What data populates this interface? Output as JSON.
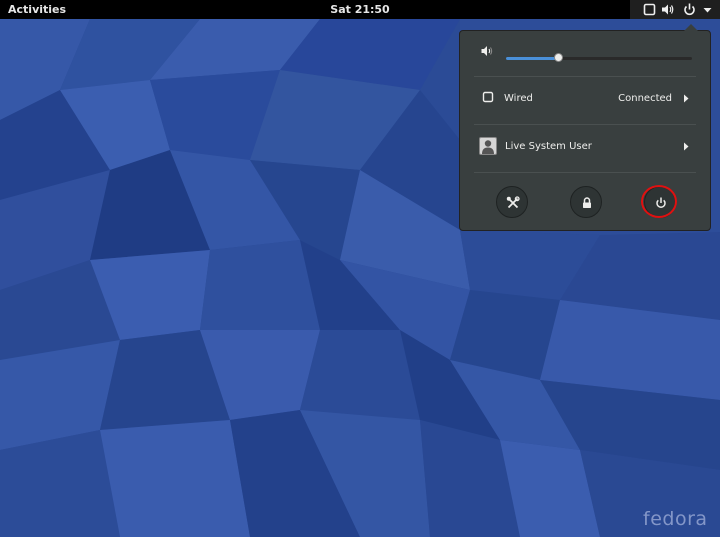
{
  "topbar": {
    "activities_label": "Activities",
    "clock": "Sat 21:50",
    "status_icons": [
      "network-wired-icon",
      "volume-icon",
      "power-icon",
      "dropdown-arrow-icon"
    ]
  },
  "system_menu": {
    "volume": {
      "icon": "speaker-icon",
      "level": 0.28
    },
    "network": {
      "icon": "network-wired-icon",
      "label": "Wired",
      "status": "Connected"
    },
    "user": {
      "icon": "user-avatar-icon",
      "label": "Live System User"
    },
    "actions": [
      {
        "name": "settings",
        "icon": "settings-tools-icon"
      },
      {
        "name": "lock",
        "icon": "lock-icon"
      },
      {
        "name": "power-off",
        "icon": "power-icon"
      }
    ],
    "accent_color": "#4a90d9",
    "highlight_color": "#e01010"
  },
  "desktop": {
    "logo_text": "fedora",
    "wallpaper_color": "#2a4a94"
  }
}
